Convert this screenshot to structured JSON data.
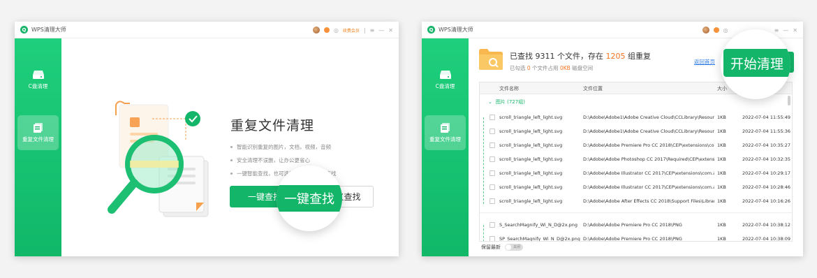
{
  "colors": {
    "brand": "#13b568",
    "accent_orange": "#f4731f",
    "link": "#2c7be5"
  },
  "window1": {
    "title": "WPS清理大师",
    "titlebar": {
      "vip_label": "续费会员",
      "menu_icon": "hamburger-icon",
      "min_icon": "minimize-icon",
      "close_icon": "close-icon"
    },
    "sidebar": [
      {
        "label": "C盘清理",
        "icon": "disk-icon",
        "active": false
      },
      {
        "label": "重复文件清理",
        "icon": "duplicate-files-icon",
        "active": true
      }
    ],
    "main": {
      "title": "重复文件清理",
      "bullets": [
        "智能识别重复的图片，文档，视频，音频",
        "安全清理不误删，让办公更省心",
        "一键智能查找，也可选择可使用自定义查找"
      ],
      "primary_button": "一键查找",
      "secondary_button": "自定义查找",
      "magnified_button": "一键查找"
    }
  },
  "window2": {
    "title": "WPS清理大师",
    "sidebar": [
      {
        "label": "C盘清理",
        "icon": "disk-icon",
        "active": false
      },
      {
        "label": "重复文件清理",
        "icon": "duplicate-files-icon",
        "active": true
      }
    ],
    "summary": {
      "line1_prefix": "已查找 9311 个文件，存在 ",
      "dup_groups": "1205",
      "line1_suffix": " 组重复",
      "line2_prefix": "已勾选 ",
      "selected_count": "0",
      "line2_mid": " 个文件占用 ",
      "selected_size": "0KB",
      "line2_suffix": " 磁盘空间"
    },
    "back_link": "返回首页",
    "start_button": "开始清理",
    "table": {
      "columns": [
        "文件名称",
        "文件位置",
        "大小"
      ],
      "group_label": "图片 (727组)",
      "rows": [
        {
          "name": "scroll_triangle_left_light.svg",
          "path": "D:\\Adobe\\Adobe1\\Adobe Creative Cloud\\CCLibrary\\Resources...",
          "size": "1KB",
          "time": "2022-07-04 11:55:49"
        },
        {
          "name": "scroll_triangle_left_light.svg",
          "path": "D:\\Adobe\\Adobe1\\Adobe Creative Cloud\\CCLibrary\\Resources...",
          "size": "1KB",
          "time": "2022-07-04 11:55:36"
        },
        {
          "name": "scroll_triangle_left_light.svg",
          "path": "D:\\Adobe\\Adobe Premiere Pro CC 2018\\CEP\\extensions\\com.a...",
          "size": "1KB",
          "time": "2022-07-04 10:35:27"
        },
        {
          "name": "scroll_triangle_left_light.svg",
          "path": "D:\\Adobe\\Adobe Photoshop CC 2017\\Required\\CEP\\extension...",
          "size": "1KB",
          "time": "2022-07-04 10:32:35"
        },
        {
          "name": "scroll_triangle_left_light.svg",
          "path": "D:\\Adobe\\Adobe Illustrator CC 2017\\CEP\\extensions\\com.ado...",
          "size": "1KB",
          "time": "2022-07-04 10:29:17"
        },
        {
          "name": "scroll_triangle_left_light.svg",
          "path": "D:\\Adobe\\Adobe Illustrator CC 2017\\CEP\\extensions\\com.ado...",
          "size": "1KB",
          "time": "2022-07-04 10:28:46"
        },
        {
          "name": "scroll_triangle_left_light.svg",
          "path": "D:\\Adobe\\Adobe After Effects CC 2018\\Support Files\\Libraries\\...",
          "size": "1KB",
          "time": "2022-07-04 10:16:26"
        },
        {
          "name": "S_SearchMagnify_Wi_N_D@2x.png",
          "path": "D:\\Adobe\\Adobe Premiere Pro CC 2018\\PNG",
          "size": "1KB",
          "time": "2022-07-04 10:38:12"
        },
        {
          "name": "SP_SearchMagnify_Wi_N_D@2x.png",
          "path": "D:\\Adobe\\Adobe Premiere Pro CC 2018\\PNG",
          "size": "1KB",
          "time": "2022-07-04 10:38:09"
        }
      ]
    },
    "footer": {
      "keep_newest": "保留最新",
      "toggle": "关闭"
    }
  }
}
